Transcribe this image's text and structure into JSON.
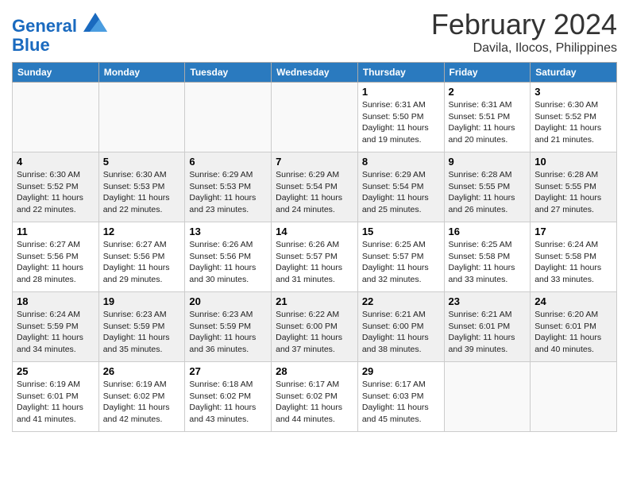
{
  "logo": {
    "line1": "General",
    "line2": "Blue"
  },
  "title": "February 2024",
  "location": "Davila, Ilocos, Philippines",
  "weekdays": [
    "Sunday",
    "Monday",
    "Tuesday",
    "Wednesday",
    "Thursday",
    "Friday",
    "Saturday"
  ],
  "weeks": [
    [
      {
        "day": "",
        "info": ""
      },
      {
        "day": "",
        "info": ""
      },
      {
        "day": "",
        "info": ""
      },
      {
        "day": "",
        "info": ""
      },
      {
        "day": "1",
        "info": "Sunrise: 6:31 AM\nSunset: 5:50 PM\nDaylight: 11 hours\nand 19 minutes."
      },
      {
        "day": "2",
        "info": "Sunrise: 6:31 AM\nSunset: 5:51 PM\nDaylight: 11 hours\nand 20 minutes."
      },
      {
        "day": "3",
        "info": "Sunrise: 6:30 AM\nSunset: 5:52 PM\nDaylight: 11 hours\nand 21 minutes."
      }
    ],
    [
      {
        "day": "4",
        "info": "Sunrise: 6:30 AM\nSunset: 5:52 PM\nDaylight: 11 hours\nand 22 minutes."
      },
      {
        "day": "5",
        "info": "Sunrise: 6:30 AM\nSunset: 5:53 PM\nDaylight: 11 hours\nand 22 minutes."
      },
      {
        "day": "6",
        "info": "Sunrise: 6:29 AM\nSunset: 5:53 PM\nDaylight: 11 hours\nand 23 minutes."
      },
      {
        "day": "7",
        "info": "Sunrise: 6:29 AM\nSunset: 5:54 PM\nDaylight: 11 hours\nand 24 minutes."
      },
      {
        "day": "8",
        "info": "Sunrise: 6:29 AM\nSunset: 5:54 PM\nDaylight: 11 hours\nand 25 minutes."
      },
      {
        "day": "9",
        "info": "Sunrise: 6:28 AM\nSunset: 5:55 PM\nDaylight: 11 hours\nand 26 minutes."
      },
      {
        "day": "10",
        "info": "Sunrise: 6:28 AM\nSunset: 5:55 PM\nDaylight: 11 hours\nand 27 minutes."
      }
    ],
    [
      {
        "day": "11",
        "info": "Sunrise: 6:27 AM\nSunset: 5:56 PM\nDaylight: 11 hours\nand 28 minutes."
      },
      {
        "day": "12",
        "info": "Sunrise: 6:27 AM\nSunset: 5:56 PM\nDaylight: 11 hours\nand 29 minutes."
      },
      {
        "day": "13",
        "info": "Sunrise: 6:26 AM\nSunset: 5:56 PM\nDaylight: 11 hours\nand 30 minutes."
      },
      {
        "day": "14",
        "info": "Sunrise: 6:26 AM\nSunset: 5:57 PM\nDaylight: 11 hours\nand 31 minutes."
      },
      {
        "day": "15",
        "info": "Sunrise: 6:25 AM\nSunset: 5:57 PM\nDaylight: 11 hours\nand 32 minutes."
      },
      {
        "day": "16",
        "info": "Sunrise: 6:25 AM\nSunset: 5:58 PM\nDaylight: 11 hours\nand 33 minutes."
      },
      {
        "day": "17",
        "info": "Sunrise: 6:24 AM\nSunset: 5:58 PM\nDaylight: 11 hours\nand 33 minutes."
      }
    ],
    [
      {
        "day": "18",
        "info": "Sunrise: 6:24 AM\nSunset: 5:59 PM\nDaylight: 11 hours\nand 34 minutes."
      },
      {
        "day": "19",
        "info": "Sunrise: 6:23 AM\nSunset: 5:59 PM\nDaylight: 11 hours\nand 35 minutes."
      },
      {
        "day": "20",
        "info": "Sunrise: 6:23 AM\nSunset: 5:59 PM\nDaylight: 11 hours\nand 36 minutes."
      },
      {
        "day": "21",
        "info": "Sunrise: 6:22 AM\nSunset: 6:00 PM\nDaylight: 11 hours\nand 37 minutes."
      },
      {
        "day": "22",
        "info": "Sunrise: 6:21 AM\nSunset: 6:00 PM\nDaylight: 11 hours\nand 38 minutes."
      },
      {
        "day": "23",
        "info": "Sunrise: 6:21 AM\nSunset: 6:01 PM\nDaylight: 11 hours\nand 39 minutes."
      },
      {
        "day": "24",
        "info": "Sunrise: 6:20 AM\nSunset: 6:01 PM\nDaylight: 11 hours\nand 40 minutes."
      }
    ],
    [
      {
        "day": "25",
        "info": "Sunrise: 6:19 AM\nSunset: 6:01 PM\nDaylight: 11 hours\nand 41 minutes."
      },
      {
        "day": "26",
        "info": "Sunrise: 6:19 AM\nSunset: 6:02 PM\nDaylight: 11 hours\nand 42 minutes."
      },
      {
        "day": "27",
        "info": "Sunrise: 6:18 AM\nSunset: 6:02 PM\nDaylight: 11 hours\nand 43 minutes."
      },
      {
        "day": "28",
        "info": "Sunrise: 6:17 AM\nSunset: 6:02 PM\nDaylight: 11 hours\nand 44 minutes."
      },
      {
        "day": "29",
        "info": "Sunrise: 6:17 AM\nSunset: 6:03 PM\nDaylight: 11 hours\nand 45 minutes."
      },
      {
        "day": "",
        "info": ""
      },
      {
        "day": "",
        "info": ""
      }
    ]
  ]
}
